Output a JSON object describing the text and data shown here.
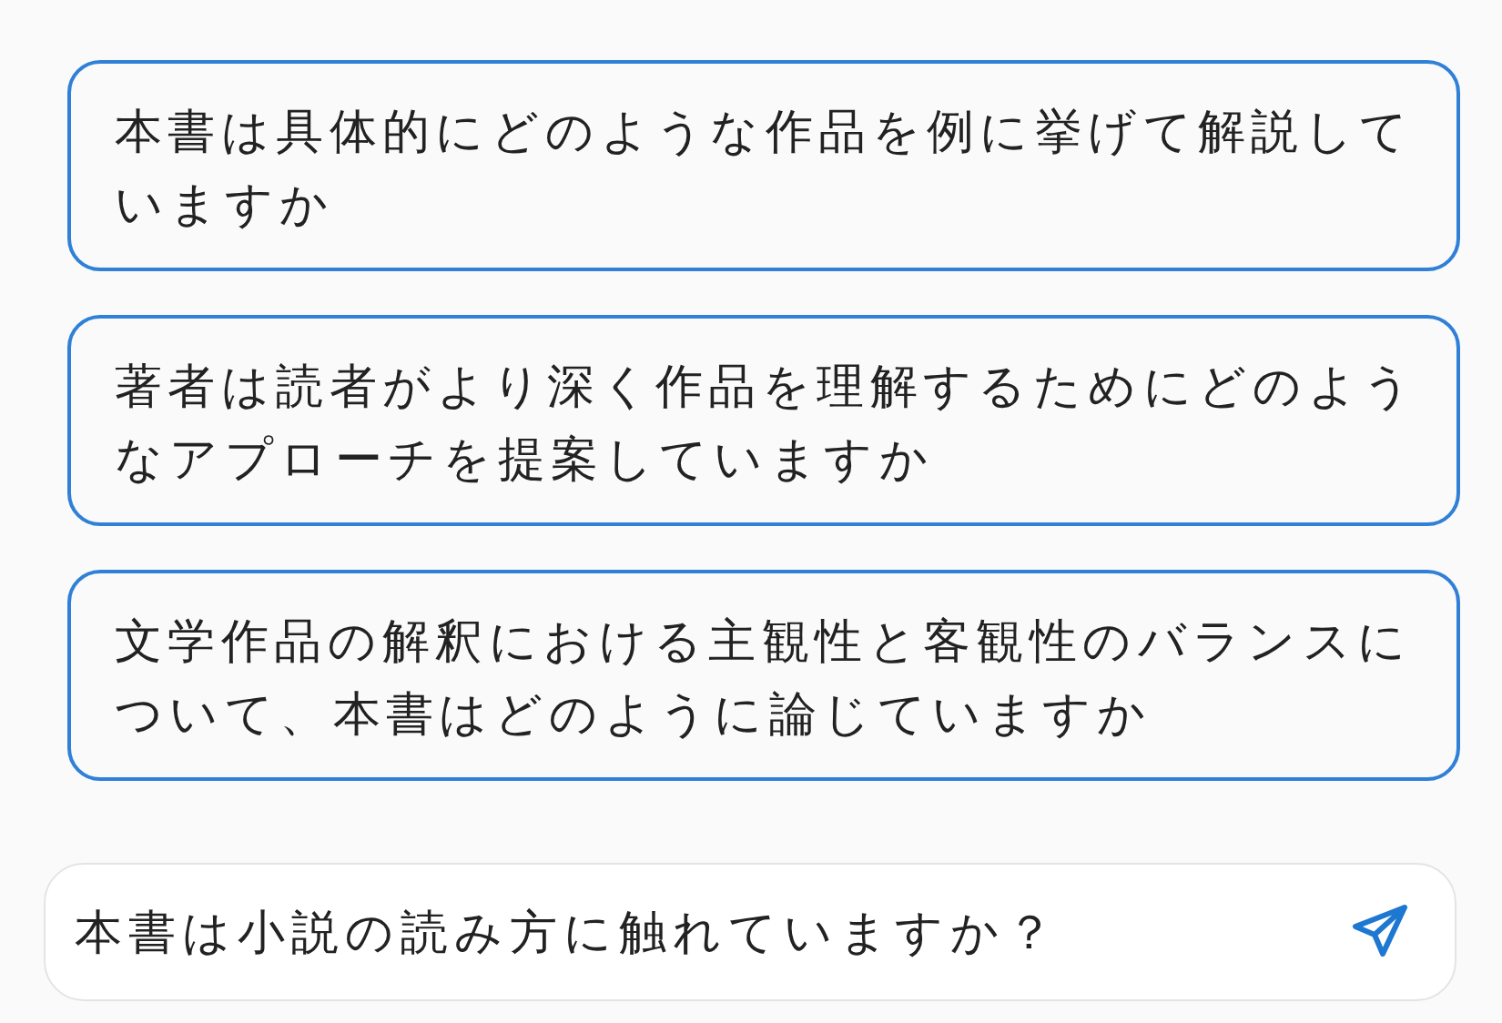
{
  "suggestions": [
    {
      "text": "本書は具体的にどのような作品を例に挙げて解説していますか"
    },
    {
      "text": "著者は読者がより深く作品を理解するためにどのようなアプローチを提案していますか"
    },
    {
      "text": "文学作品の解釈における主観性と客観性のバランスについて、本書はどのように論じていますか"
    }
  ],
  "input": {
    "value": "本書は小説の読み方に触れていますか？"
  }
}
